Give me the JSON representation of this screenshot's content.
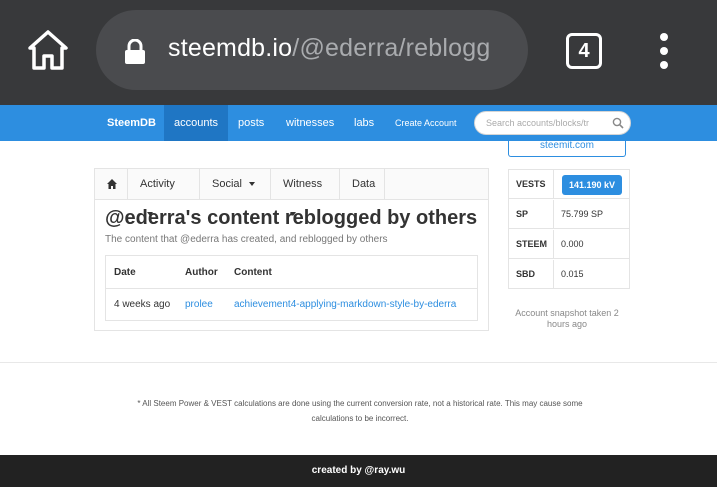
{
  "browser": {
    "url_domain": "steemdb.io",
    "url_path": "/@ederra/reblogg",
    "tab_count": "4"
  },
  "navbar": {
    "brand": "SteemDB",
    "items": [
      "accounts",
      "posts",
      "witnesses",
      "labs"
    ],
    "create_account": "Create Account",
    "search_placeholder": "Search accounts/blocks/tr"
  },
  "steemit_link": "steemit.com",
  "subnav": {
    "activity": "Activity",
    "social": "Social",
    "witness": "Witness",
    "data": "Data"
  },
  "page": {
    "title": "@ederra's content reblogged by others",
    "subtitle": "The content that @ederra has created, and reblogged by others"
  },
  "table": {
    "headers": [
      "Date",
      "Author",
      "Content"
    ],
    "rows": [
      {
        "date": "4 weeks ago",
        "author": "prolee",
        "content": "achievement4-applying-markdown-style-by-ederra"
      }
    ]
  },
  "sidebar": {
    "rows": [
      {
        "label": "VESTS",
        "value": "141.190 kV"
      },
      {
        "label": "SP",
        "value": "75.799 SP"
      },
      {
        "label": "STEEM",
        "value": "0.000"
      },
      {
        "label": "SBD",
        "value": "0.015"
      }
    ],
    "snapshot": "Account snapshot taken 2 hours ago"
  },
  "footnote": "* All Steem Power & VEST calculations are done using the current conversion rate, not a historical rate. This may cause some calculations to be incorrect.",
  "footer": "created by @ray.wu",
  "colors": {
    "chrome": "#38393b",
    "navbar": "#2d8ee0",
    "nav_active": "#1f76c4",
    "link": "#2d8ee0",
    "footer": "#222222"
  }
}
